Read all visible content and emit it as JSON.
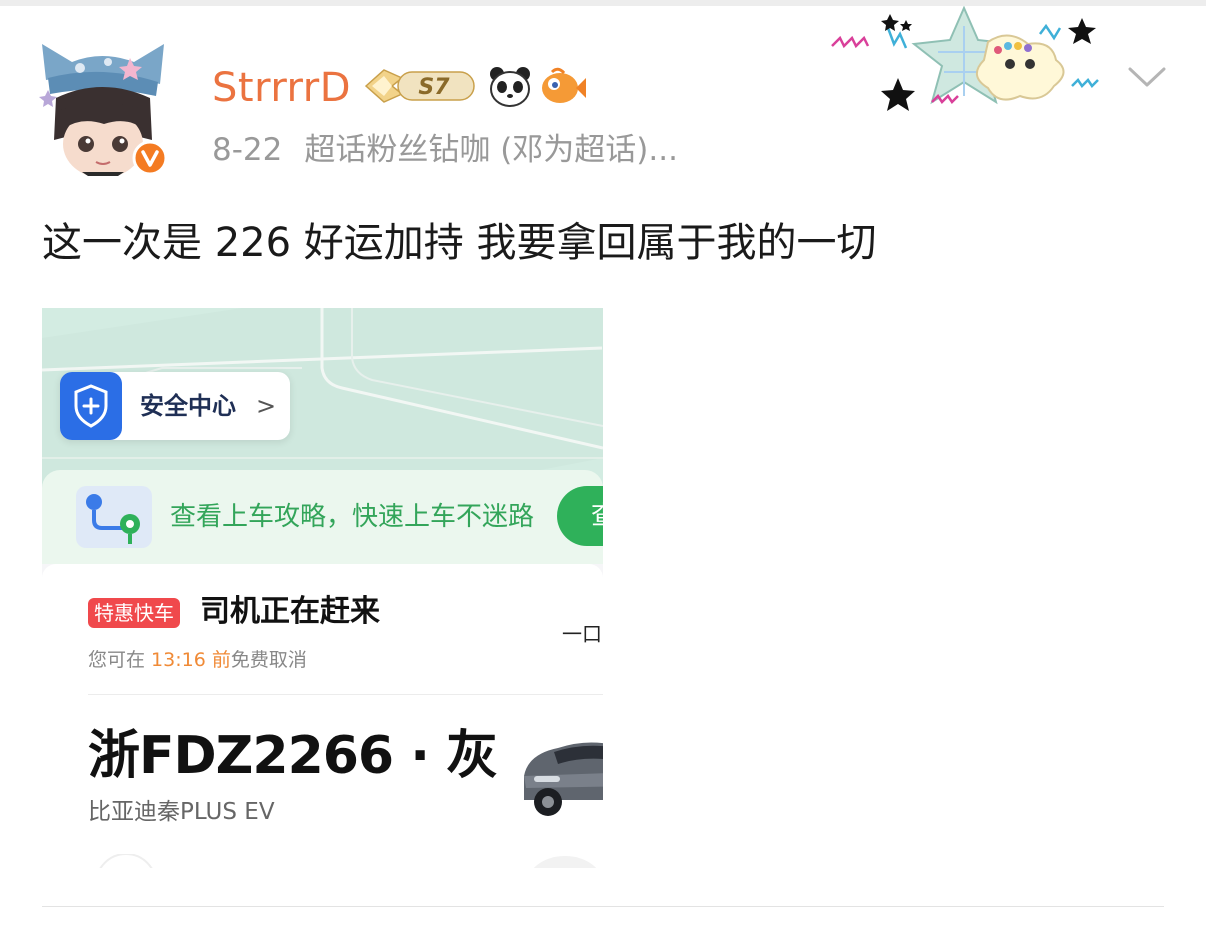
{
  "post": {
    "username": "StrrrrD",
    "level_badge": "S7",
    "date": "8-22",
    "source": "超话粉丝钻咖 (邓为超话)...",
    "text": "这一次是 226 好运加持 我要拿回属于我的一切"
  },
  "icons": {
    "avatar": "avatar-image",
    "verified": "verified-v-icon",
    "level": "s7-level-badge",
    "panda": "panda-icon",
    "fish": "fish-icon",
    "more": "chevron-down-icon",
    "decoration": "star-sparkle-decoration"
  },
  "colors": {
    "username": "#eb7340",
    "meta": "#999999",
    "accent_green": "#33a55a",
    "tag_red": "#f0494c"
  },
  "embedded_screenshot": {
    "safety_center": "安全中心",
    "safety_arrow": ">",
    "pickup_guide": "查看上车攻略，快速上车不迷路",
    "guide_button": "查",
    "service_tag": "特惠快车",
    "status": "司机正在赶来",
    "cancel_prefix": "您可在 ",
    "cancel_time": "13:16",
    "cancel_mid": " 前",
    "cancel_suffix": "免费取消",
    "trailing_text": "一口",
    "plate": "浙FDZ2266 · 灰",
    "car_model": "比亚迪秦PLUS EV"
  }
}
